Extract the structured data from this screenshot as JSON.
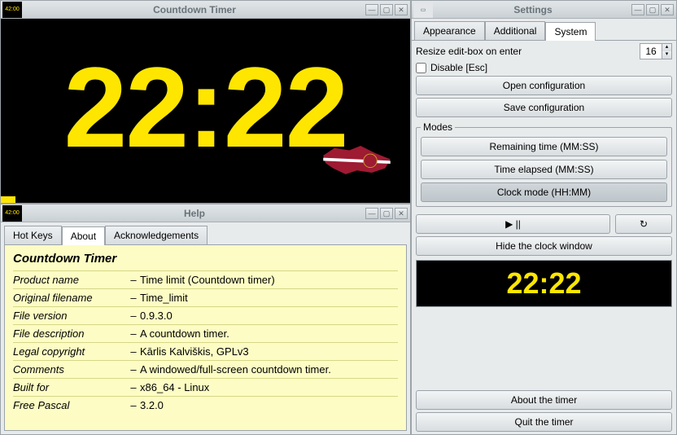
{
  "timer": {
    "title": "Countdown Timer",
    "app_icon_text": "42:00",
    "display": "22:22"
  },
  "help": {
    "title": "Help",
    "tabs": {
      "hotkeys": "Hot Keys",
      "about": "About",
      "ack": "Acknowledgements"
    },
    "about": {
      "heading": "Countdown Timer",
      "rows": [
        {
          "label": "Product name",
          "value": "Time limit (Countdown timer)"
        },
        {
          "label": "Original filename",
          "value": "Time_limit"
        },
        {
          "label": "File version",
          "value": "0.9.3.0"
        },
        {
          "label": "File description",
          "value": "A countdown timer."
        },
        {
          "label": "Legal copyright",
          "value": "Kārlis Kalviškis, GPLv3"
        },
        {
          "label": "Comments",
          "value": "A windowed/full-screen countdown timer."
        },
        {
          "label": "Built for",
          "value": "x86_64 - Linux"
        },
        {
          "label": "Free Pascal",
          "value": "3.2.0"
        }
      ]
    }
  },
  "settings": {
    "title": "Settings",
    "tabs": {
      "appearance": "Appearance",
      "additional": "Additional",
      "system": "System"
    },
    "resize_label": "Resize edit-box on enter",
    "resize_value": "16",
    "disable_esc": "Disable [Esc]",
    "open_cfg": "Open configuration",
    "save_cfg": "Save configuration",
    "modes_legend": "Modes",
    "mode_remaining": "Remaining time (MM:SS)",
    "mode_elapsed": "Time elapsed (MM:SS)",
    "mode_clock": "Clock mode (HH:MM)",
    "play_pause": "▶ ||",
    "reload": "↻",
    "hide": "Hide the clock window",
    "preview": "22:22",
    "about_btn": "About the timer",
    "quit_btn": "Quit the timer"
  }
}
